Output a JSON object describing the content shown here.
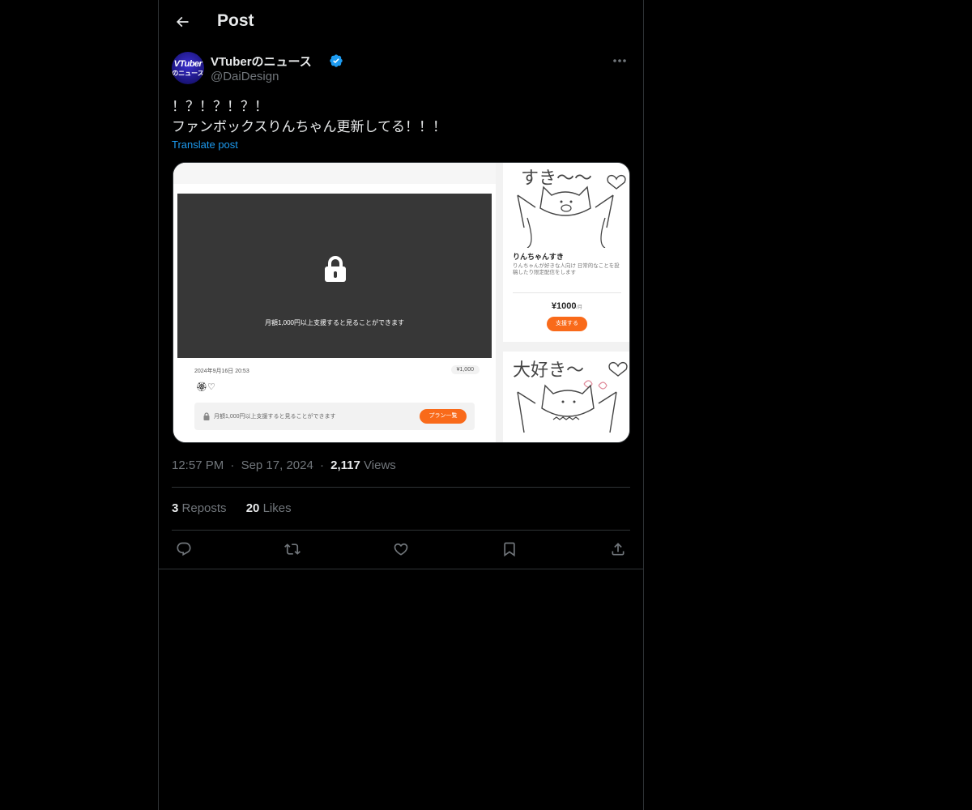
{
  "header": {
    "title": "Post",
    "back_icon": "arrow-left-icon"
  },
  "author": {
    "display_name": "VTuberのニュース",
    "handle": "@DaiDesign",
    "verified": true,
    "verified_color": "#1d9bf0",
    "avatar_line1": "VTuber",
    "avatar_line2": "のニュース"
  },
  "post": {
    "text_line1": "！？！？！？！",
    "text_line2": "ファンボックスりんちゃん更新してる！！！",
    "translate_label": "Translate post"
  },
  "media": {
    "locked_text": "月額1,000円以上支援すると見ることができます",
    "post_date": "2024年9月16日 20:53",
    "price_pill": "¥1,000",
    "emoji_row": "🏵♡",
    "support_text": "月額1,000円以上支援すると見ることができます",
    "plan_button": "プラン一覧",
    "right_top_handwriting": "すき〜〜",
    "plan_title": "りんちゃんすき",
    "plan_desc": "りんちゃんが好きな人向け 日常的なことを投稿したり限定配信をします",
    "plan_price": "¥1000",
    "plan_price_unit": "/月",
    "plan_support_button": "支援する",
    "right_bottom_handwriting": "大好き〜",
    "accent_color": "#f96a1a"
  },
  "meta": {
    "time": "12:57 PM",
    "separator": "·",
    "date": "Sep 17, 2024",
    "views_count": "2,117",
    "views_label": "Views"
  },
  "stats": {
    "reposts_count": "3",
    "reposts_label": "Reposts",
    "likes_count": "20",
    "likes_label": "Likes"
  },
  "actions": {
    "reply": "reply-icon",
    "repost": "repost-icon",
    "like": "heart-icon",
    "bookmark": "bookmark-icon",
    "share": "share-icon"
  }
}
